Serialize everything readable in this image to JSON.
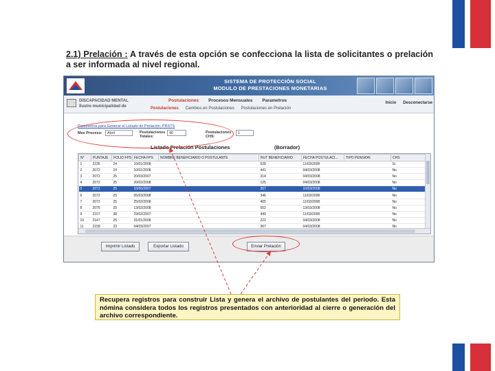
{
  "intro": {
    "step": "2.1) Prelación :",
    "text": " A través de esta opción se confecciona la lista de solicitantes  o prelación a ser informada al nivel regional."
  },
  "app": {
    "banner": {
      "line1": "SISTEMA DE PROTECCIÓN SOCIAL",
      "line2": "MODULO DE PRESTACIONES MONETARIAS"
    },
    "dept": {
      "line1": "DISCAPACIDAD MENTAL",
      "line2": "Ilustre municipalidad de"
    },
    "menu": [
      "Postulaciones",
      "Procesos Mensuales",
      "Parametros"
    ],
    "menu_right": [
      "Inicio",
      "Desconectarse"
    ],
    "submenu": [
      "Postulaciones",
      "Cambios en Postulaciones",
      "Postulaciones en Prelación"
    ],
    "params": {
      "title": "Parametros para Generar el Listado de Prelación: PRSTS",
      "mes_label": "Mes Proceso:",
      "mes_value": "Abril",
      "total_label_1": "Postulaciones",
      "total_label_2": "Totales:",
      "total_value": "46",
      "chs_label_1": "Postulaciones",
      "chs_label_2": "CHS:",
      "chs_value": "1"
    },
    "list_title": "Listado Prelación Postulaciones",
    "list_state": "(Borrador)",
    "table": {
      "headers": [
        "N°",
        "PUNTAJE",
        "FOLIO FPS",
        "FECHA FPS",
        "NOMBRE BENEFICIARIO O POSTULANTE",
        "RUT BENEFICIARIO",
        "FECHA POSTULACI...",
        "TIPO PENSION",
        "CHS"
      ],
      "rows": [
        [
          "1",
          "2235",
          "24",
          "10/01/2008",
          "",
          "528",
          "11/03/2008",
          "",
          "Si"
        ],
        [
          "2",
          "2072",
          "24",
          "10/01/2008",
          "",
          "441",
          "04/03/2008",
          "",
          "No"
        ],
        [
          "3",
          "2072",
          "25",
          "20/03/2007",
          "",
          "314",
          "04/03/2008",
          "",
          "No"
        ],
        [
          "4",
          "2072",
          "25",
          "20/02/2008",
          "",
          "125",
          "04/03/2008",
          "",
          "No"
        ],
        [
          "5",
          "2072",
          "25",
          "10/06/2007",
          "",
          "357",
          "10/03/2008",
          "",
          "No"
        ],
        [
          "6",
          "2072",
          "25",
          "05/03/2008",
          "",
          "346",
          "11/03/2008",
          "",
          "No"
        ],
        [
          "7",
          "2072",
          "25",
          "25/02/2008",
          "",
          "465",
          "11/03/2008",
          "",
          "No"
        ],
        [
          "8",
          "2076",
          "25",
          "13/02/2008",
          "",
          "552",
          "13/03/2008",
          "",
          "No"
        ],
        [
          "9",
          "2107",
          "38",
          "29/02/2007",
          "",
          "449",
          "11/03/2008",
          "",
          "No"
        ],
        [
          "10",
          "2147",
          "25",
          "31/01/2008",
          "",
          "222",
          "04/03/2008",
          "",
          "No"
        ],
        [
          "11",
          "2158",
          "23",
          "04/03/2007",
          "",
          "367",
          "04/03/2008",
          "",
          "No"
        ]
      ],
      "selected_row": 4
    },
    "buttons": {
      "imprimir": "Imprimir Listado",
      "exportar": "Exportar Listado",
      "enviar": "Enviar Prelación"
    }
  },
  "note": "Recupera registros para construir Lista  y genera  el archivo de postulantes del periodo.  Esta nómina considera  todos  los  registros  presentados  con  anterioridad  al  cierre  o  generación  del  archivo correspondiente.",
  "colors": {
    "flag_blue": "#1b4fa0",
    "flag_red": "#d6303a",
    "annotation_red": "#e03a3a",
    "selected_row": "#2f5fb0",
    "note_bg": "#fdf5c4"
  }
}
